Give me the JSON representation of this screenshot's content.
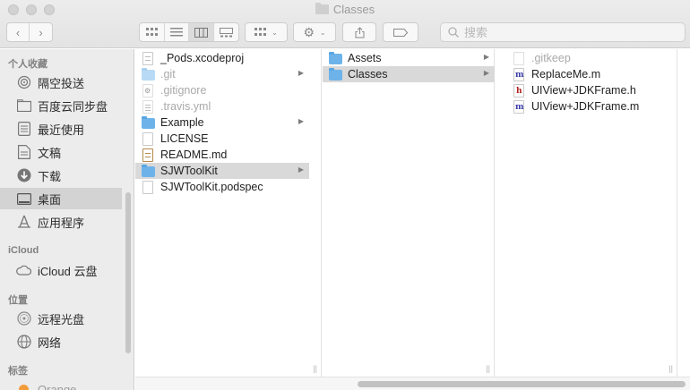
{
  "window": {
    "title": "Classes"
  },
  "search": {
    "placeholder": "搜索"
  },
  "sidebar": {
    "favorites_label": "个人收藏",
    "favorites": [
      {
        "label": "隔空投送",
        "icon": "airdrop-icon"
      },
      {
        "label": "百度云同步盘",
        "icon": "folder-icon"
      },
      {
        "label": "最近使用",
        "icon": "recents-icon"
      },
      {
        "label": "文稿",
        "icon": "documents-icon"
      },
      {
        "label": "下载",
        "icon": "downloads-icon"
      },
      {
        "label": "桌面",
        "icon": "desktop-icon",
        "selected": true
      },
      {
        "label": "应用程序",
        "icon": "applications-icon"
      }
    ],
    "icloud_label": "iCloud",
    "icloud": [
      {
        "label": "iCloud 云盘",
        "icon": "cloud-icon"
      }
    ],
    "locations_label": "位置",
    "locations": [
      {
        "label": "远程光盘",
        "icon": "disc-icon"
      },
      {
        "label": "网络",
        "icon": "network-icon"
      }
    ],
    "tags_label": "标签",
    "tags": [
      {
        "label": "Orange",
        "color": "#f39c3a"
      }
    ]
  },
  "column1": [
    {
      "name": "_Pods.xcodeproj",
      "kind": "doc"
    },
    {
      "name": ".git",
      "kind": "folder-pale",
      "dim": true,
      "arrow": true
    },
    {
      "name": ".gitignore",
      "kind": "doc-gear",
      "dim": true
    },
    {
      "name": ".travis.yml",
      "kind": "doc-lines",
      "dim": true
    },
    {
      "name": "Example",
      "kind": "folder",
      "arrow": true
    },
    {
      "name": "LICENSE",
      "kind": "doc"
    },
    {
      "name": "README.md",
      "kind": "doc-md"
    },
    {
      "name": "SJWToolKit",
      "kind": "folder",
      "arrow": true,
      "selected": true
    },
    {
      "name": "SJWToolKit.podspec",
      "kind": "doc"
    }
  ],
  "column2": [
    {
      "name": "Assets",
      "kind": "folder",
      "arrow": true
    },
    {
      "name": "Classes",
      "kind": "folder",
      "arrow": true,
      "selected": true
    }
  ],
  "column3": [
    {
      "name": ".gitkeep",
      "kind": "doc-faint",
      "dim": true
    },
    {
      "name": "ReplaceMe.m",
      "kind": "doc-m"
    },
    {
      "name": "UIView+JDKFrame.h",
      "kind": "doc-h"
    },
    {
      "name": "UIView+JDKFrame.m",
      "kind": "doc-m"
    }
  ]
}
